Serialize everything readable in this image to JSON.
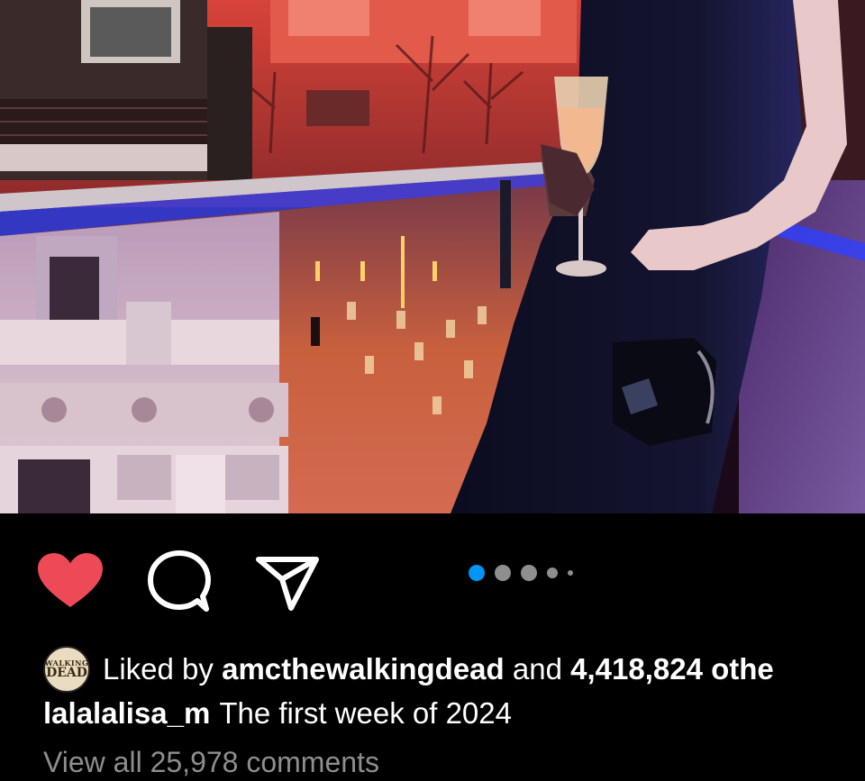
{
  "post": {
    "image_alt": "Woman in black dress holding champagne flute on a balcony overlooking a lit plaza at night",
    "carousel": {
      "current": 1,
      "total": 5
    }
  },
  "actions": {
    "like_icon": "heart-icon",
    "like_color": "#ed4956",
    "comment_icon": "comment-icon",
    "share_icon": "share-icon",
    "active_dot_color": "#0095f6"
  },
  "likes": {
    "avatar_text_1": "WALKING",
    "avatar_text_2": "DEAD",
    "prefix": "Liked by",
    "user": "amcthewalkingdead",
    "and": "and",
    "count": "4,418,824 othe"
  },
  "caption": {
    "username": "lalalalisa_m",
    "text": "The first week of 2024"
  },
  "comments": {
    "view_all_label": "View all 25,978 comments"
  }
}
